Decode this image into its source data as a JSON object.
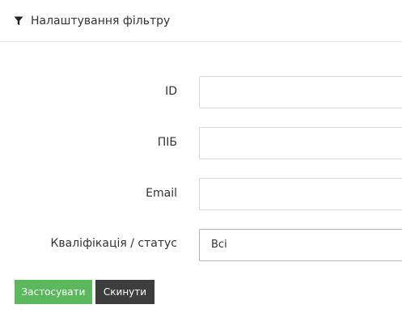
{
  "header": {
    "title": "Налаштування фільтру",
    "icon": "filter-icon"
  },
  "form": {
    "id_label": "ID",
    "id_value": "",
    "name_label": "ПІБ",
    "name_value": "",
    "email_label": "Email",
    "email_value": "",
    "status_label": "Кваліфікація / статус",
    "status_selected": "Всі"
  },
  "actions": {
    "apply_label": "Застосувати",
    "reset_label": "Скинути"
  },
  "colors": {
    "apply": "#5cb85c",
    "reset": "#3d3d3d",
    "border": "#dadada",
    "text": "#333333"
  }
}
